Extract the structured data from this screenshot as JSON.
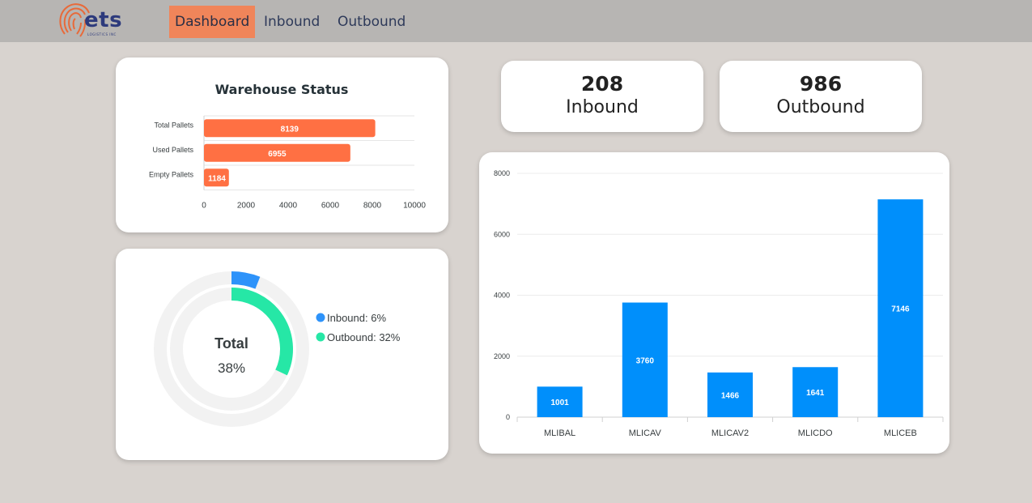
{
  "brand": {
    "logo_text": "ets",
    "logo_subtext": "LOGISTICS INC"
  },
  "nav": {
    "items": [
      {
        "label": "Dashboard",
        "active": true
      },
      {
        "label": "Inbound",
        "active": false
      },
      {
        "label": "Outbound",
        "active": false
      }
    ]
  },
  "kpis": [
    {
      "value": "208",
      "label": "Inbound"
    },
    {
      "value": "986",
      "label": "Outbound"
    }
  ],
  "colors": {
    "accent_orange": "#ff7043",
    "bar_blue": "#008ffb",
    "donut_blue": "#2e93fa",
    "donut_green": "#26e7a6"
  },
  "chart_data": [
    {
      "type": "bar",
      "orientation": "horizontal",
      "title": "Warehouse Status",
      "categories": [
        "Total Pallets",
        "Used Pallets",
        "Empty Pallets"
      ],
      "values": [
        8139,
        6955,
        1184
      ],
      "xlim": [
        0,
        10000
      ],
      "xticks": [
        0,
        2000,
        4000,
        6000,
        8000,
        10000
      ],
      "grid": true,
      "data_labels": true
    },
    {
      "type": "pie",
      "variant": "radial-bar",
      "center_label": "Total",
      "center_value": "38%",
      "series": [
        {
          "name": "Inbound",
          "value": 6,
          "legend": "Inbound: 6%"
        },
        {
          "name": "Outbound",
          "value": 32,
          "legend": "Outbound: 32%"
        }
      ],
      "legend_position": "right"
    },
    {
      "type": "bar",
      "orientation": "vertical",
      "categories": [
        "MLIBAL",
        "MLICAV",
        "MLICAV2",
        "MLICDO",
        "MLICEB"
      ],
      "values": [
        1001,
        3760,
        1466,
        1641,
        7146
      ],
      "ylim": [
        0,
        8000
      ],
      "yticks": [
        0,
        2000,
        4000,
        6000,
        8000
      ],
      "grid": true,
      "data_labels": true
    }
  ]
}
